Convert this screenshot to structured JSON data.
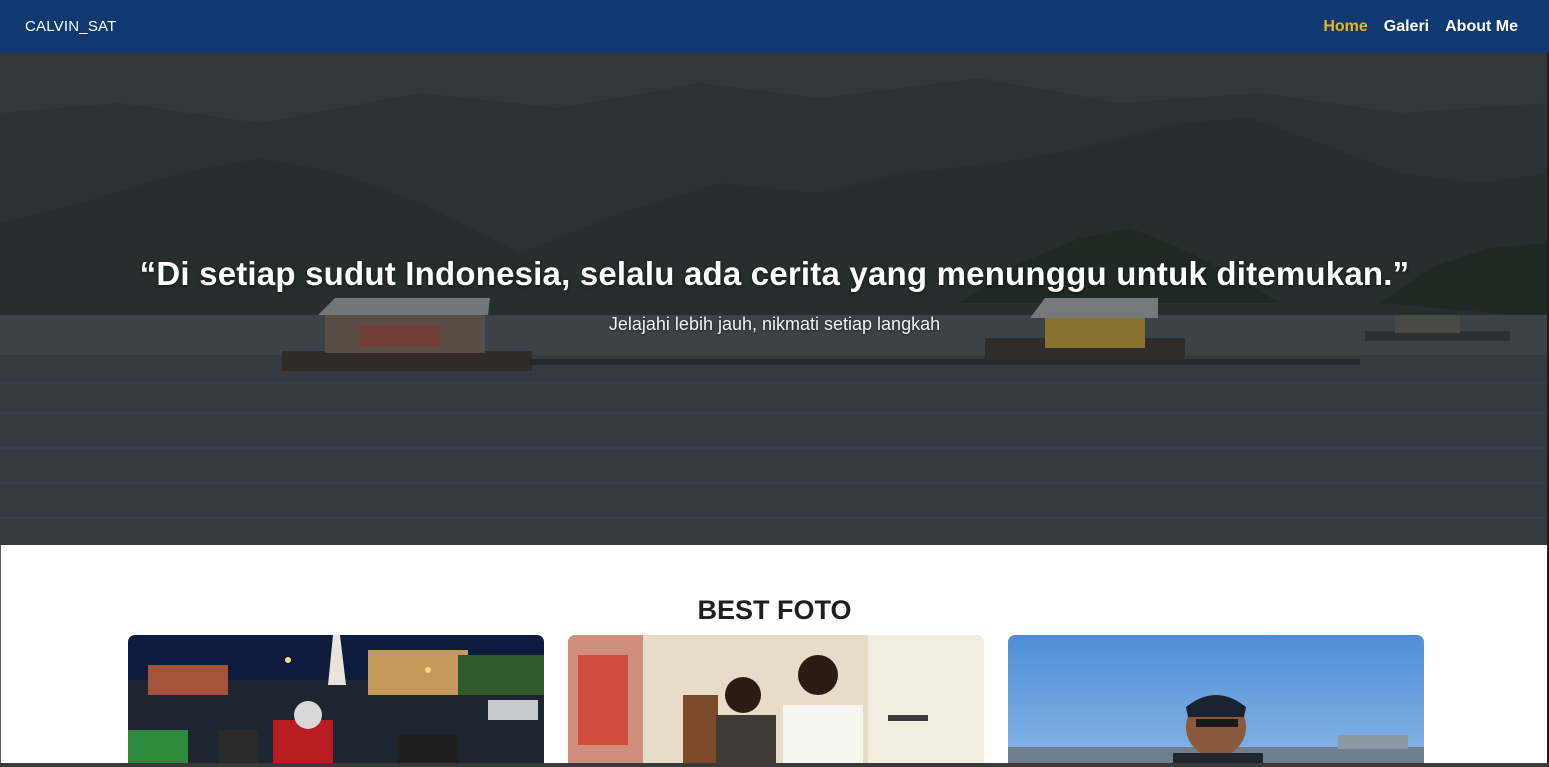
{
  "navbar": {
    "brand": "CALVIN_SAT",
    "links": [
      {
        "label": "Home",
        "active": true
      },
      {
        "label": "Galeri",
        "active": false
      },
      {
        "label": "About Me",
        "active": false
      }
    ],
    "bg_color": "#0f3970",
    "active_color": "#e8b526"
  },
  "hero": {
    "title": "“Di setiap sudut Indonesia, selalu ada cerita yang menunggu untuk ditemukan.”",
    "subtitle": "Jelajahi lebih jauh, nikmati setiap langkah"
  },
  "best_foto": {
    "title": "BEST FOTO"
  }
}
